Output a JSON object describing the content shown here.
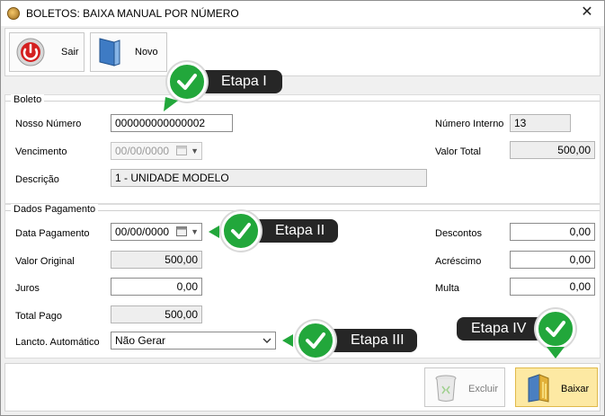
{
  "window": {
    "title": "BOLETOS: BAIXA MANUAL POR NÚMERO",
    "close_label": "✕"
  },
  "toolbar": {
    "sair_label": "Sair",
    "novo_label": "Novo"
  },
  "boleto": {
    "group_label": "Boleto",
    "nosso_numero_label": "Nosso Número",
    "nosso_numero_value": "000000000000002",
    "vencimento_label": "Vencimento",
    "vencimento_value": "00/00/0000",
    "descricao_label": "Descrição",
    "descricao_value": "1 - UNIDADE MODELO",
    "numero_interno_label": "Número Interno",
    "numero_interno_value": "13",
    "valor_total_label": "Valor Total",
    "valor_total_value": "500,00"
  },
  "pagamento": {
    "group_label": "Dados Pagamento",
    "data_pagamento_label": "Data Pagamento",
    "data_pagamento_value": "00/00/0000",
    "valor_original_label": "Valor Original",
    "valor_original_value": "500,00",
    "juros_label": "Juros",
    "juros_value": "0,00",
    "total_pago_label": "Total Pago",
    "total_pago_value": "500,00",
    "lancto_label": "Lancto. Automático",
    "lancto_value": "Não Gerar",
    "descontos_label": "Descontos",
    "descontos_value": "0,00",
    "acrescimo_label": "Acréscimo",
    "acrescimo_value": "0,00",
    "multa_label": "Multa",
    "multa_value": "0,00"
  },
  "footer": {
    "excluir_label": "Excluir",
    "baixar_label": "Baixar"
  },
  "callouts": {
    "etapa1": "Etapa I",
    "etapa2": "Etapa II",
    "etapa3": "Etapa III",
    "etapa4": "Etapa IV"
  },
  "colors": {
    "callout_bg": "#262626",
    "check_green": "#22a73b",
    "active_button": "#fde9a3"
  }
}
